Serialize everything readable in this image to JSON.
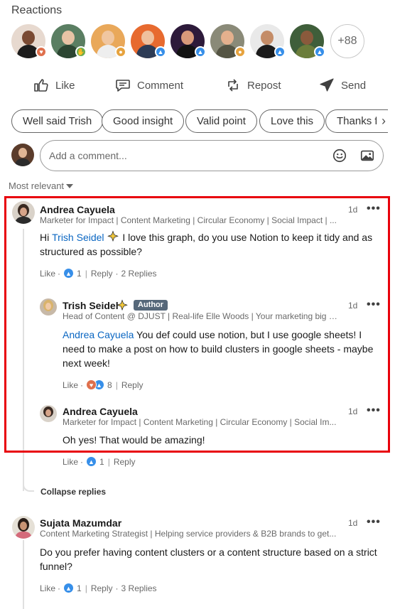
{
  "reactions": {
    "title": "Reactions",
    "avatars": [
      {
        "name": "reactor-1",
        "badge": "heart",
        "bg": "#e7d9cf",
        "skin": "#7a4a33",
        "shirt": "#1c1c1c",
        "badge_color": "#df704d"
      },
      {
        "name": "reactor-2",
        "badge": "support",
        "bg": "#5a7e62",
        "skin": "#e8c3a5",
        "shirt": "#2c4632",
        "badge_color": "#6dae4f"
      },
      {
        "name": "reactor-3",
        "badge": "insightful",
        "bg": "#e9a85a",
        "skin": "#f0c6a0",
        "shirt": "#eeeeee",
        "badge_color": "#e7a33e"
      },
      {
        "name": "reactor-4",
        "badge": "like",
        "bg": "#e76a2f",
        "skin": "#efc09d",
        "shirt": "#2d3b55",
        "badge_color": "#378fe9"
      },
      {
        "name": "reactor-5",
        "badge": "like",
        "bg": "#2d1a3a",
        "skin": "#d89a7a",
        "shirt": "#121212",
        "badge_color": "#378fe9"
      },
      {
        "name": "reactor-6",
        "badge": "insightful",
        "bg": "#8a8a78",
        "skin": "#e4b08d",
        "shirt": "#555544",
        "badge_color": "#e7a33e"
      },
      {
        "name": "reactor-7",
        "badge": "like",
        "bg": "#e9e9e9",
        "skin": "#c48c67",
        "shirt": "#1b1b1b",
        "badge_color": "#378fe9"
      },
      {
        "name": "reactor-8",
        "badge": "like",
        "bg": "#3f5e3a",
        "skin": "#8a5a3c",
        "shirt": "#6b7d3b",
        "badge_color": "#378fe9"
      }
    ],
    "more": "+88"
  },
  "actions": {
    "like": "Like",
    "comment": "Comment",
    "repost": "Repost",
    "send": "Send"
  },
  "chips": [
    "Well said Trish",
    "Good insight",
    "Valid point",
    "Love this",
    "Thanks for"
  ],
  "composer": {
    "placeholder": "Add a comment..."
  },
  "sort": {
    "label": "Most relevant"
  },
  "comments": [
    {
      "name": "Andrea Cayuela",
      "headline": "Marketer for Impact | Content Marketing | Circular Economy | Social Impact | ...",
      "time": "1d",
      "mention": "Trish Seidel",
      "text_prefix": "Hi",
      "text": "I love this graph, do you use Notion to keep it tidy and as structured as possible?",
      "like_label": "Like",
      "reaction_count": "1",
      "reply_label": "Reply",
      "replies_label": "2 Replies"
    },
    {
      "name": "Trish Seidel",
      "badge": "Author",
      "headline": "Head of Content @ DJUST | Real-life Elle Woods | Your marketing big si...",
      "time": "1d",
      "mention": "Andrea Cayuela",
      "text": "You def could use notion, but I use google sheets! I need to make a post on how to build clusters in google sheets - maybe next week!",
      "like_label": "Like",
      "reaction_count": "8",
      "reply_label": "Reply"
    },
    {
      "name": "Andrea Cayuela",
      "headline": "Marketer for Impact | Content Marketing | Circular Economy | Social Im...",
      "time": "1d",
      "text": "Oh yes! That would be amazing!",
      "like_label": "Like",
      "reaction_count": "1",
      "reply_label": "Reply"
    },
    {
      "name": "Sujata Mazumdar",
      "headline": "Content Marketing Strategist | Helping service providers & B2B brands to get...",
      "time": "1d",
      "text": "Do you prefer having content clusters or a content structure based on a strict funnel?",
      "like_label": "Like",
      "reaction_count": "1",
      "reply_label": "Reply",
      "replies_label": "3 Replies"
    }
  ],
  "collapse_label": "Collapse replies",
  "colors": {
    "link": "#0a66c2",
    "highlight": "#e8000b",
    "author_badge": "#56687a"
  }
}
